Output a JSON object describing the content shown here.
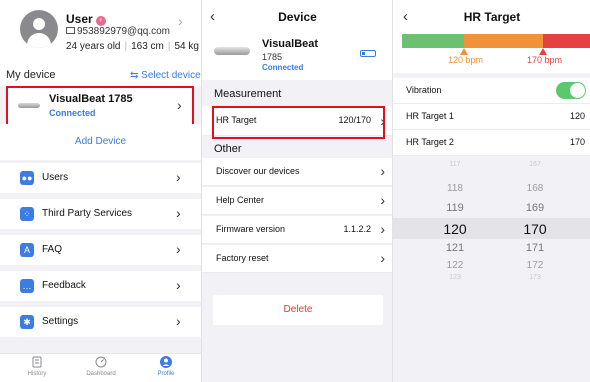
{
  "profile": {
    "username": "User",
    "gender_glyph": "♀",
    "email": "953892979@qq.com",
    "age": "24 years old",
    "height": "163 cm",
    "weight": "54 kg",
    "my_device_label": "My device",
    "select_device_label": "Select device",
    "device_name": "VisualBeat 1785",
    "device_status": "Connected",
    "add_device_label": "Add Device",
    "menu": [
      {
        "label": "Users",
        "icon": "users-icon"
      },
      {
        "label": "Third Party Services",
        "icon": "apps-icon"
      },
      {
        "label": "FAQ",
        "icon": "faq-icon"
      },
      {
        "label": "Feedback",
        "icon": "chat-icon"
      },
      {
        "label": "Settings",
        "icon": "gear-icon"
      }
    ],
    "tabs": [
      {
        "label": "History"
      },
      {
        "label": "Dashboard"
      },
      {
        "label": "Profile"
      }
    ]
  },
  "device": {
    "title": "Device",
    "name": "VisualBeat",
    "model": "1785",
    "status": "Connected",
    "measurement_header": "Measurement",
    "hr_target_label": "HR Target",
    "hr_target_value": "120/170",
    "other_header": "Other",
    "discover_label": "Discover our devices",
    "help_label": "Help Center",
    "firmware_label": "Firmware version",
    "firmware_value": "1.1.2.2",
    "factory_reset_label": "Factory reset",
    "delete_label": "Delete"
  },
  "hr_target": {
    "title": "HR Target",
    "low_marker": "120 bpm",
    "high_marker": "170 bpm",
    "vibration_label": "Vibration",
    "vibration_on": true,
    "target1_label": "HR Target 1",
    "target1_value": "120",
    "target2_label": "HR Target 2",
    "target2_value": "170",
    "picker_left": [
      "117",
      "118",
      "119",
      "120",
      "121",
      "122",
      "123"
    ],
    "picker_right": [
      "167",
      "168",
      "169",
      "170",
      "171",
      "172",
      "173"
    ],
    "colors": {
      "green": "#6cc070",
      "orange": "#f0923a",
      "red": "#e74040"
    }
  },
  "colors": {
    "accent": "#3d7ce4",
    "highlight_box": "#e0101e",
    "delete": "#e03a3a"
  }
}
